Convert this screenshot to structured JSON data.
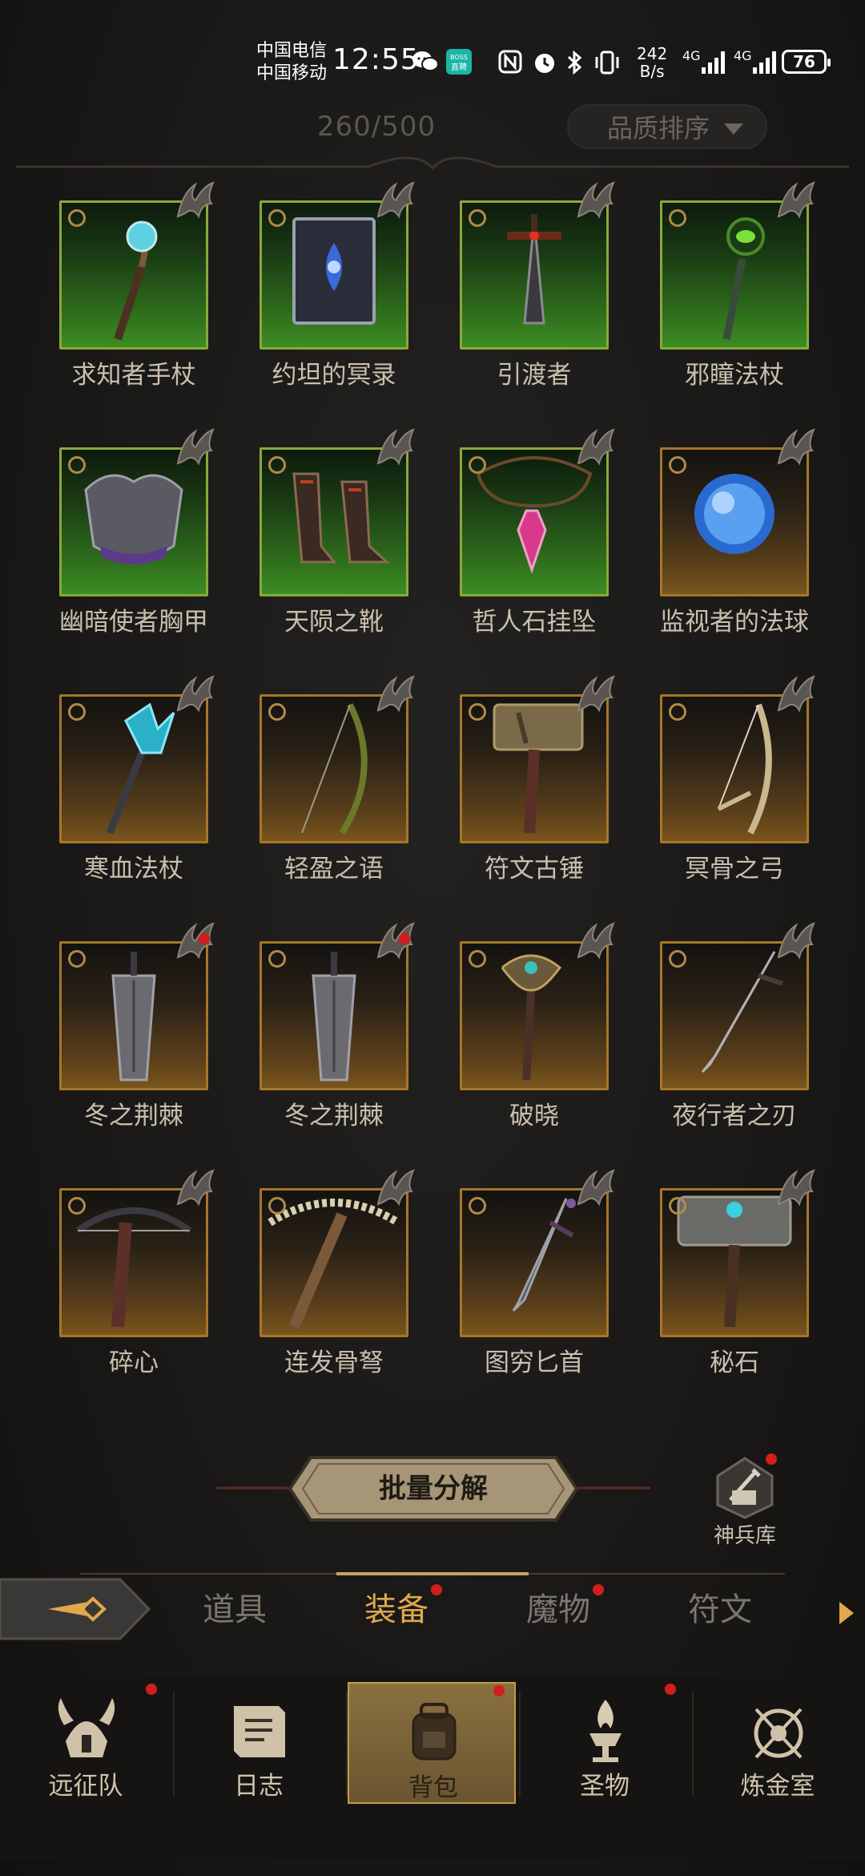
{
  "status_bar": {
    "carrier_1": "中国电信",
    "carrier_2": "中国移动",
    "time": "12:55",
    "app_badge": "BOSS直聘",
    "net_speed_value": "242",
    "net_speed_unit": "B/s",
    "network_1": "4G",
    "network_2": "4G",
    "battery": "76"
  },
  "inventory": {
    "capacity": "260/500",
    "sort_label": "品质排序",
    "items": [
      {
        "name": "求知者手杖",
        "rarity": "epic",
        "icon": "staff-orb-icon",
        "new": false
      },
      {
        "name": "约坦的冥录",
        "rarity": "epic",
        "icon": "tome-icon",
        "new": false
      },
      {
        "name": "引渡者",
        "rarity": "epic",
        "icon": "greatsword-icon",
        "new": false
      },
      {
        "name": "邪瞳法杖",
        "rarity": "epic",
        "icon": "staff-eye-icon",
        "new": false
      },
      {
        "name": "幽暗使者胸甲",
        "rarity": "epic",
        "icon": "chest-armor-icon",
        "new": false
      },
      {
        "name": "天陨之靴",
        "rarity": "epic",
        "icon": "boots-icon",
        "new": false
      },
      {
        "name": "哲人石挂坠",
        "rarity": "epic",
        "icon": "pendant-icon",
        "new": false
      },
      {
        "name": "监视者的法球",
        "rarity": "legend",
        "icon": "orb-icon",
        "new": false
      },
      {
        "name": "寒血法杖",
        "rarity": "legend",
        "icon": "ice-staff-icon",
        "new": false
      },
      {
        "name": "轻盈之语",
        "rarity": "legend",
        "icon": "longbow-icon",
        "new": false
      },
      {
        "name": "符文古锤",
        "rarity": "legend",
        "icon": "hammer-icon",
        "new": false
      },
      {
        "name": "冥骨之弓",
        "rarity": "legend",
        "icon": "bone-bow-icon",
        "new": false
      },
      {
        "name": "冬之荆棘",
        "rarity": "legend",
        "icon": "broadsword-icon",
        "new": true
      },
      {
        "name": "冬之荆棘",
        "rarity": "legend",
        "icon": "broadsword-icon",
        "new": true
      },
      {
        "name": "破晓",
        "rarity": "legend",
        "icon": "scepter-icon",
        "new": false
      },
      {
        "name": "夜行者之刃",
        "rarity": "legend",
        "icon": "dagger-blade-icon",
        "new": false
      },
      {
        "name": "碎心",
        "rarity": "legend",
        "icon": "crossbow-icon",
        "new": false
      },
      {
        "name": "连发骨弩",
        "rarity": "legend",
        "icon": "bone-crossbow-icon",
        "new": false
      },
      {
        "name": "图穷匕首",
        "rarity": "legend",
        "icon": "dagger-icon",
        "new": false
      },
      {
        "name": "秘石",
        "rarity": "legend",
        "icon": "stone-hammer-icon",
        "new": false
      }
    ]
  },
  "actions": {
    "batch_decompose": "批量分解",
    "armory": "神兵库"
  },
  "tabs": [
    {
      "label": "道具",
      "active": false,
      "dot": false
    },
    {
      "label": "装备",
      "active": true,
      "dot": true
    },
    {
      "label": "魔物",
      "active": false,
      "dot": true
    },
    {
      "label": "符文",
      "active": false,
      "dot": false
    }
  ],
  "nav": [
    {
      "label": "远征队",
      "icon": "helmet-icon",
      "active": false,
      "dot": true
    },
    {
      "label": "日志",
      "icon": "scroll-icon",
      "active": false,
      "dot": false
    },
    {
      "label": "背包",
      "icon": "backpack-icon",
      "active": true,
      "dot": true
    },
    {
      "label": "圣物",
      "icon": "brazier-icon",
      "active": false,
      "dot": true
    },
    {
      "label": "炼金室",
      "icon": "alchemy-icon",
      "active": false,
      "dot": false
    }
  ],
  "colors": {
    "accent": "#e0a84a",
    "epic_tile": "#3c8d24",
    "legend_tile": "#7a551c",
    "notify": "#d21e1e"
  }
}
